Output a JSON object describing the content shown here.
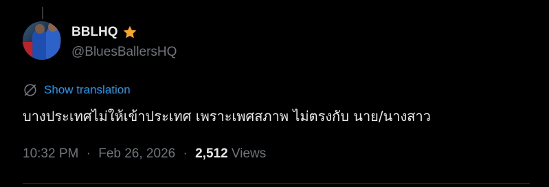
{
  "author": {
    "display_name": "BBLHQ",
    "handle": "@BluesBallersHQ",
    "badge_icon": "star-icon",
    "badge_color": "#f7a62a"
  },
  "tweet": {
    "translate_icon": "globe-slash-icon",
    "show_translation_label": "Show translation",
    "text": "บางประเทศไม่ให้เข้าประเทศ เพราะเพศสภาพ ไม่ตรงกับ นาย/นางสาว"
  },
  "meta": {
    "time": "10:32 PM",
    "separator": "·",
    "date": "Feb 26, 2026",
    "views_count": "2,512",
    "views_label": "Views"
  },
  "colors": {
    "background": "#000000",
    "text_primary": "#e7e9ea",
    "text_secondary": "#71767b",
    "link": "#1d9bf0",
    "divider": "#2f3336"
  }
}
